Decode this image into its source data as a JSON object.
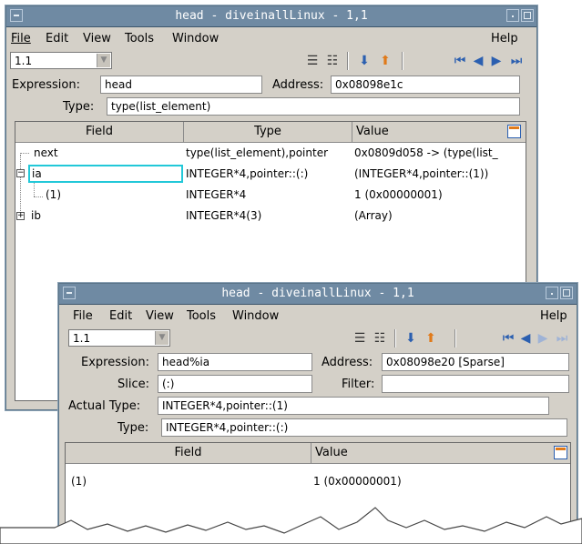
{
  "window1": {
    "title": "head - diveinallLinux - 1,1",
    "menu": {
      "file": "File",
      "edit": "Edit",
      "view": "View",
      "tools": "Tools",
      "window": "Window",
      "help": "Help"
    },
    "combo_value": "1.1",
    "expression_label": "Expression:",
    "expression_value": "head",
    "address_label": "Address:",
    "address_value": "0x08098e1c",
    "type_label": "Type:",
    "type_value": "type(list_element)",
    "columns": {
      "field": "Field",
      "type": "Type",
      "value": "Value"
    },
    "rows": [
      {
        "field": "next",
        "type": "type(list_element),pointer",
        "value": "0x0809d058 -> (type(list_"
      },
      {
        "field": "ia",
        "type": "INTEGER*4,pointer::(:)",
        "value": "(INTEGER*4,pointer::(1))"
      },
      {
        "field": "(1)",
        "type": "INTEGER*4",
        "value": "1 (0x00000001)"
      },
      {
        "field": "ib",
        "type": "INTEGER*4(3)",
        "value": "(Array)"
      }
    ]
  },
  "window2": {
    "title": "head - diveinallLinux - 1,1",
    "menu": {
      "file": "File",
      "edit": "Edit",
      "view": "View",
      "tools": "Tools",
      "window": "Window",
      "help": "Help"
    },
    "combo_value": "1.1",
    "expression_label": "Expression:",
    "expression_value": "head%ia",
    "address_label": "Address:",
    "address_value": "0x08098e20  [Sparse]",
    "slice_label": "Slice:",
    "slice_value": "(:)",
    "filter_label": "Filter:",
    "filter_value": "",
    "actual_type_label": "Actual Type:",
    "actual_type_value": "INTEGER*4,pointer::(1)",
    "type_label": "Type:",
    "type_value": "INTEGER*4,pointer::(:)",
    "columns": {
      "field": "Field",
      "value": "Value"
    },
    "rows": [
      {
        "field": "(1)",
        "value": "1 (0x00000001)"
      }
    ]
  },
  "icons": [
    "menu-icon",
    "minimize-icon",
    "maximize-icon",
    "dive-icon",
    "undive-icon",
    "first-icon",
    "prev-icon",
    "next-icon",
    "last-icon",
    "column-chooser-icon"
  ]
}
